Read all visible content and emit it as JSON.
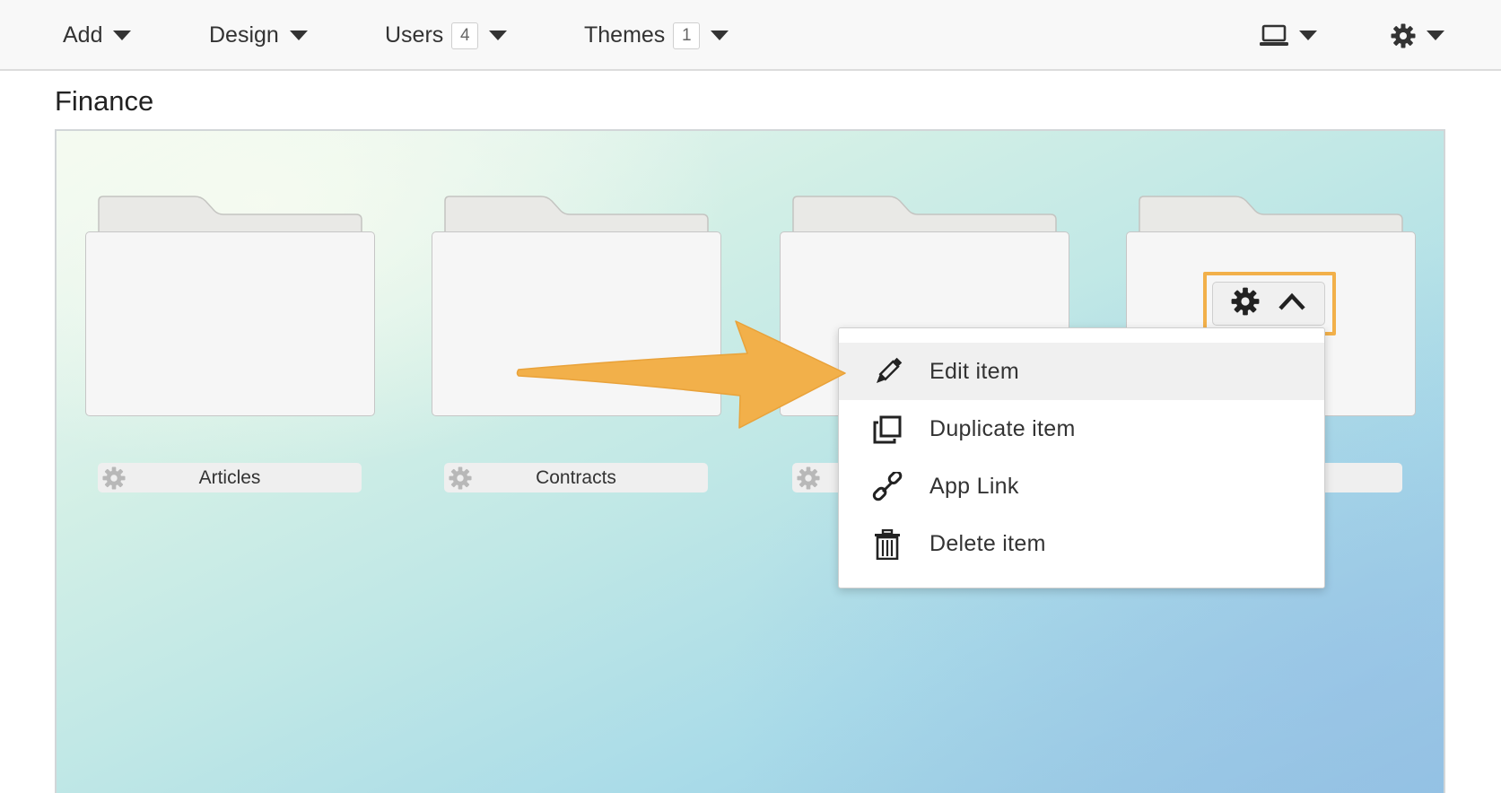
{
  "toolbar": {
    "add_label": "Add",
    "design_label": "Design",
    "users_label": "Users",
    "users_count": "4",
    "themes_label": "Themes",
    "themes_count": "1",
    "device_icon": "laptop-icon",
    "settings_icon": "gear-icon"
  },
  "page": {
    "title": "Finance"
  },
  "folders": [
    {
      "label": "Articles"
    },
    {
      "label": "Contracts"
    },
    {
      "label": ""
    },
    {
      "label": ""
    }
  ],
  "selected_folder_controls": {
    "gear_icon": "gear-icon",
    "toggle_icon": "chevron-up-icon"
  },
  "context_menu": {
    "items": [
      {
        "label": "Edit item",
        "icon": "pencil-icon"
      },
      {
        "label": "Duplicate item",
        "icon": "duplicate-icon"
      },
      {
        "label": "App Link",
        "icon": "link-icon"
      },
      {
        "label": "Delete item",
        "icon": "trash-icon"
      }
    ]
  },
  "colors": {
    "highlight": "#f2b04a",
    "arrow": "#f2b04a"
  }
}
